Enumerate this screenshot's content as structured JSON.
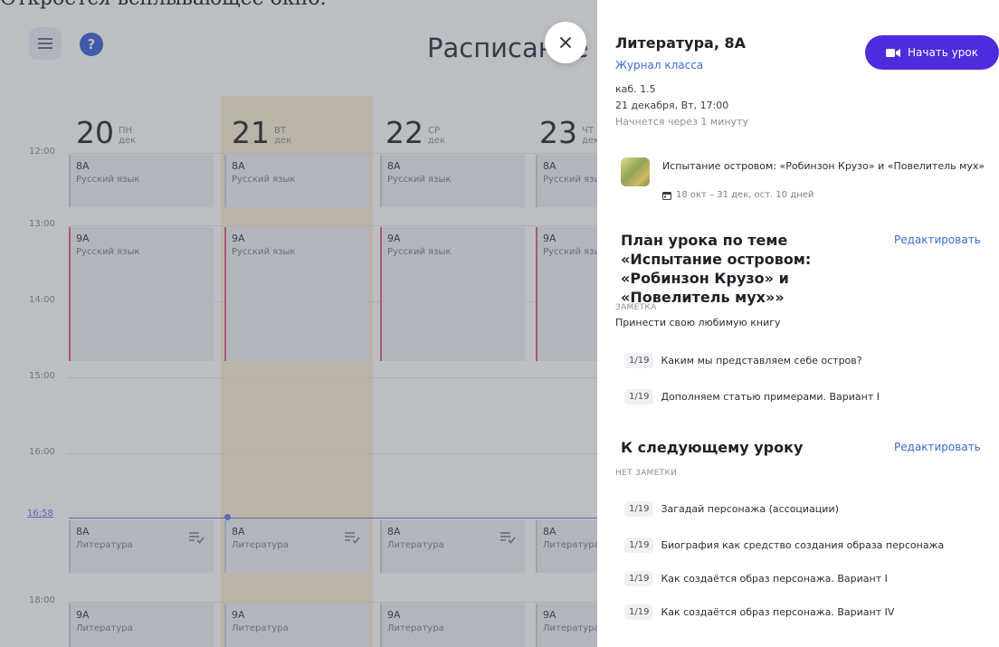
{
  "caption": "Откроется всплывающее окно.",
  "header": {
    "title": "Расписание"
  },
  "times": [
    "12:00",
    "13:00",
    "14:00",
    "15:00",
    "16:00",
    "16:58",
    "18:00"
  ],
  "days": [
    {
      "num": "20",
      "dow": "ПН",
      "mon": "дек"
    },
    {
      "num": "21",
      "dow": "ВТ",
      "mon": "дек"
    },
    {
      "num": "22",
      "dow": "СР",
      "mon": "дек"
    },
    {
      "num": "23",
      "dow": "ЧТ",
      "mon": "дек"
    }
  ],
  "lessons": {
    "row1": {
      "cls": "8А",
      "subj": "Русский язык"
    },
    "row2": {
      "cls": "9А",
      "subj": "Русский язык"
    },
    "row3": {
      "cls": "8А",
      "subj": "Литература"
    },
    "row4": {
      "cls": "9А",
      "subj": "Литература"
    }
  },
  "panel": {
    "title": "Литература, 8А",
    "journal_link": "Журнал класса",
    "start_button": "Начать урок",
    "room": "каб. 1.5",
    "datetime": "21 декабря, Вт, 17:00",
    "starts_in": "Начнется через 1 минуту",
    "topic": {
      "title": "Испытание островом: «Робинзон Крузо» и «Повелитель мух»",
      "dates": "18 окт – 31 дек, ост. 10 дней"
    },
    "plan": {
      "title": "План урока по теме «Испытание островом: «Робинзон Крузо» и «Повелитель мух»»",
      "edit": "Редактировать",
      "note_label": "ЗАМЕТКА",
      "note": "Принести свою любимую книгу",
      "tasks": [
        {
          "badge": "1/19",
          "label": "Каким мы представляем себе остров?"
        },
        {
          "badge": "1/19",
          "label": "Дополняем статью примерами. Вариант I"
        }
      ]
    },
    "next": {
      "title": "К следующему уроку",
      "edit": "Редактировать",
      "note_label": "НЕТ ЗАМЕТКИ",
      "tasks": [
        {
          "badge": "1/19",
          "label": "Загадай персонажа (ассоциации)"
        },
        {
          "badge": "1/19",
          "label": "Биография как средство создания образа персонажа"
        },
        {
          "badge": "1/19",
          "label": "Как создаётся образ персонажа. Вариант I"
        },
        {
          "badge": "1/19",
          "label": "Как создаётся образ персонажа. Вариант IV"
        }
      ]
    }
  },
  "colors": {
    "accent": "#4e2bdc",
    "link": "#3b6bd8",
    "today": "#fcefd6",
    "current_line": "#6d79f0"
  }
}
